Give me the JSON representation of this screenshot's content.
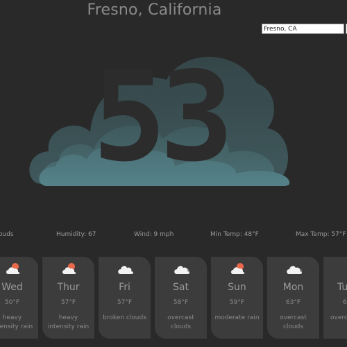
{
  "location": {
    "title": "Fresno, California",
    "search_value": "Fresno, CA"
  },
  "current": {
    "temperature": "53",
    "icon": "cloud-icon",
    "conditions_partial": "ouds",
    "humidity": "Humidity: 67",
    "wind": "Wind: 9 mph",
    "min_temp": "Min Temp: 48°F",
    "max_temp": "Max Temp: 57°F"
  },
  "forecast": [
    {
      "day": "Wed",
      "temp": "50°F",
      "desc": "heavy intensity rain",
      "icon": "cloud-sun-icon"
    },
    {
      "day": "Thur",
      "temp": "57°F",
      "desc": "heavy intensity rain",
      "icon": "cloud-sun-icon"
    },
    {
      "day": "Fri",
      "temp": "57°F",
      "desc": "broken clouds",
      "icon": "cloud-icon"
    },
    {
      "day": "Sat",
      "temp": "58°F",
      "desc": "overcast clouds",
      "icon": "cloud-icon"
    },
    {
      "day": "Sun",
      "temp": "59°F",
      "desc": "moderate rain",
      "icon": "cloud-sun-icon"
    },
    {
      "day": "Mon",
      "temp": "63°F",
      "desc": "overcast clouds",
      "icon": "cloud-icon"
    },
    {
      "day": "Tu",
      "temp": "6",
      "desc": "overc",
      "icon": "cloud-icon"
    }
  ],
  "colors": {
    "background": "#292929",
    "card": "#3c3c3c",
    "cloud_back": "#3b4e52",
    "cloud_mid": "#46656a",
    "cloud_front": "#4f7a80",
    "sun": "#e8694a"
  }
}
